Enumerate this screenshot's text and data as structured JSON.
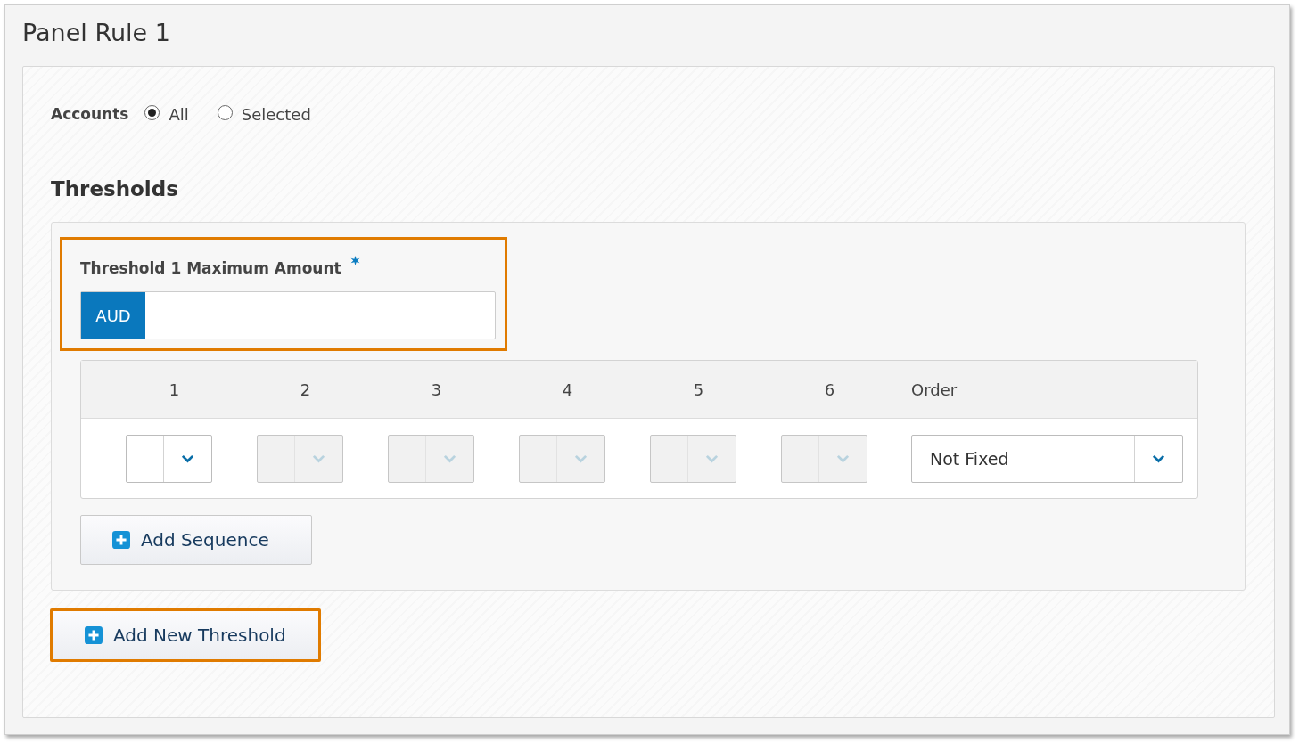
{
  "title": "Panel Rule 1",
  "accounts": {
    "label": "Accounts",
    "options": [
      {
        "label": "All",
        "selected": true
      },
      {
        "label": "Selected",
        "selected": false
      }
    ]
  },
  "thresholds_heading": "Thresholds",
  "threshold": {
    "label": "Threshold 1 Maximum Amount",
    "required": true,
    "currency": "AUD",
    "highlighted": true
  },
  "sequence": [
    {
      "label": "1",
      "disabled": false
    },
    {
      "label": "2",
      "disabled": true
    },
    {
      "label": "3",
      "disabled": true
    },
    {
      "label": "4",
      "disabled": true
    },
    {
      "label": "5",
      "disabled": true
    },
    {
      "label": "6",
      "disabled": true
    }
  ],
  "order": {
    "label": "Order",
    "value": "Not Fixed"
  },
  "add_sequence": {
    "label": "Add Sequence",
    "highlighted": false
  },
  "add_threshold": {
    "label": "Add New Threshold",
    "highlighted": true
  }
}
